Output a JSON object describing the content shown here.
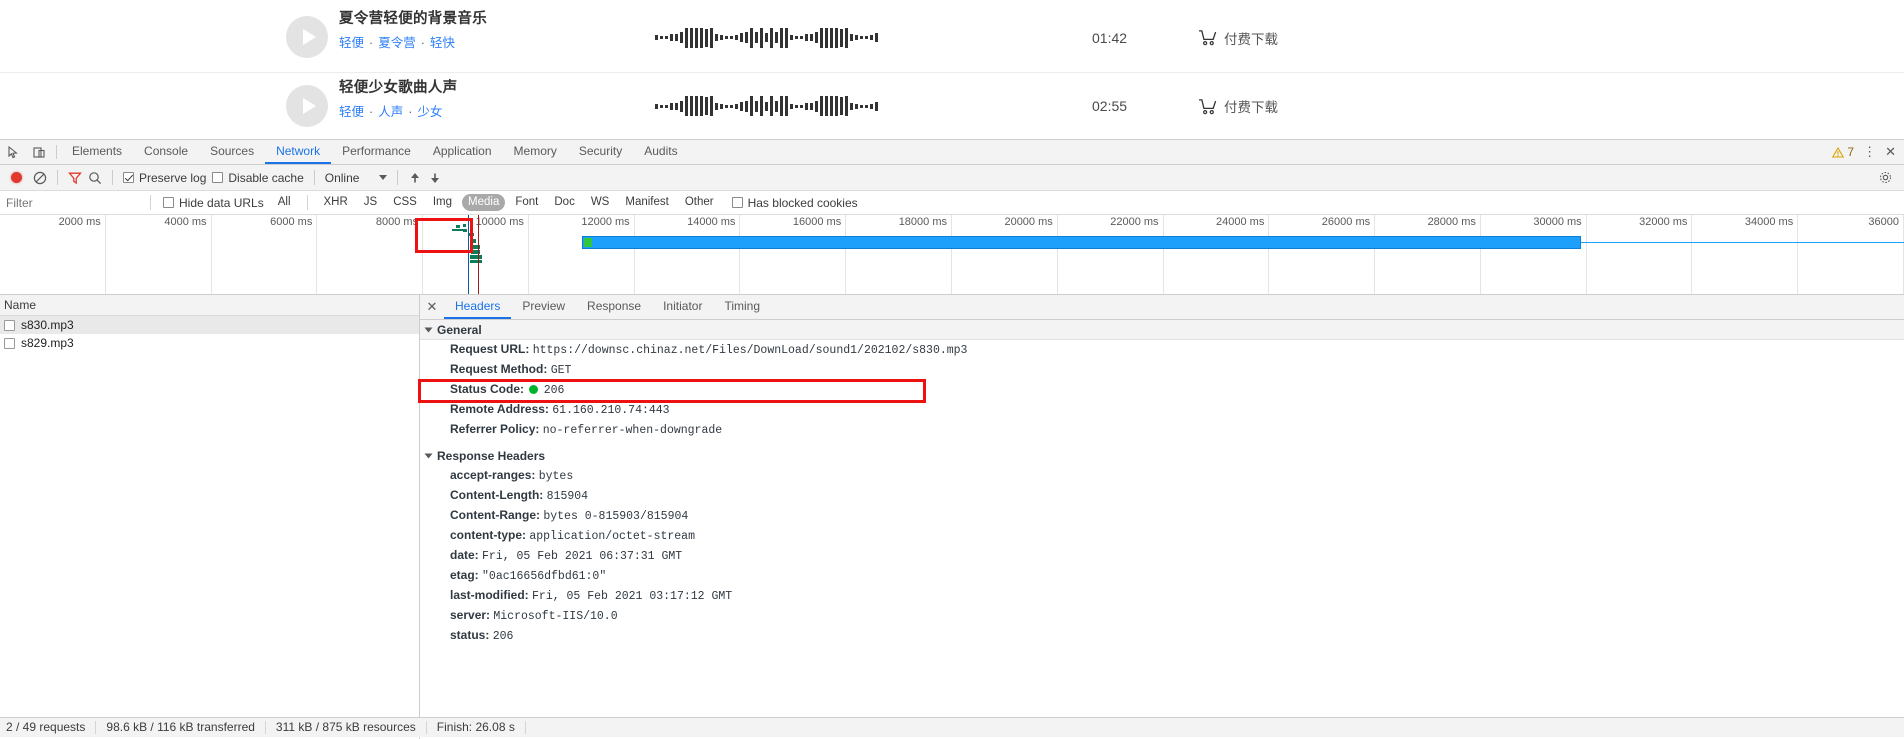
{
  "webpage": {
    "tracks": [
      {
        "title": "夏令营轻便的背景音乐",
        "tags": [
          "轻便",
          "夏令营",
          "轻快"
        ],
        "duration": "01:42",
        "download_label": "付费下载"
      },
      {
        "title": "轻便少女歌曲人声",
        "tags": [
          "轻便",
          "人声",
          "少女"
        ],
        "duration": "02:55",
        "download_label": "付费下载"
      }
    ],
    "waveform_heights": [
      5,
      3,
      3,
      7,
      7,
      11,
      20,
      20,
      20,
      20,
      18,
      20,
      7,
      5,
      3,
      3,
      5,
      9,
      11,
      20,
      11,
      20,
      9,
      20,
      11,
      20,
      20
    ]
  },
  "devtools": {
    "main_tabs": [
      {
        "label": "Elements",
        "active": false
      },
      {
        "label": "Console",
        "active": false
      },
      {
        "label": "Sources",
        "active": false
      },
      {
        "label": "Network",
        "active": true
      },
      {
        "label": "Performance",
        "active": false
      },
      {
        "label": "Application",
        "active": false
      },
      {
        "label": "Memory",
        "active": false
      },
      {
        "label": "Security",
        "active": false
      },
      {
        "label": "Audits",
        "active": false
      }
    ],
    "warning_count": "7",
    "icons": {
      "inspect": "inspect-element-icon",
      "device": "device-toolbar-icon",
      "warning": "warning-triangle-icon",
      "more": "more-vertical-icon",
      "close": "close-icon",
      "settings": "gear-icon"
    },
    "network_toolbar": {
      "record_title": "record-button",
      "clear_title": "clear-button",
      "filter_title": "filter-button",
      "search_title": "search-button",
      "preserve_log_label": "Preserve log",
      "preserve_log_checked": true,
      "disable_cache_label": "Disable cache",
      "disable_cache_checked": false,
      "throttling_value": "Online",
      "import_title": "import-har-button",
      "export_title": "export-har-button"
    },
    "filter_bar": {
      "filter_placeholder": "Filter",
      "hide_data_urls_label": "Hide data URLs",
      "hide_data_urls_checked": false,
      "types": [
        {
          "label": "All",
          "selected": false
        },
        {
          "label": "XHR",
          "selected": false
        },
        {
          "label": "JS",
          "selected": false
        },
        {
          "label": "CSS",
          "selected": false
        },
        {
          "label": "Img",
          "selected": false
        },
        {
          "label": "Media",
          "selected": true
        },
        {
          "label": "Font",
          "selected": false
        },
        {
          "label": "Doc",
          "selected": false
        },
        {
          "label": "WS",
          "selected": false
        },
        {
          "label": "Manifest",
          "selected": false
        },
        {
          "label": "Other",
          "selected": false
        }
      ],
      "blocked_cookies_label": "Has blocked cookies",
      "blocked_cookies_checked": false
    },
    "overview": {
      "ticks": [
        "2000 ms",
        "4000 ms",
        "6000 ms",
        "8000 ms",
        "10000 ms",
        "12000 ms",
        "14000 ms",
        "16000 ms",
        "18000 ms",
        "20000 ms",
        "22000 ms",
        "24000 ms",
        "26000 ms",
        "28000 ms",
        "30000 ms",
        "32000 ms",
        "34000 ms",
        "36000"
      ],
      "bar_start_ms": 11000,
      "bar_end_ms": 29900,
      "max_ms": 36000,
      "bar_color": "#1ca0fb",
      "start_marker_color": "#33c73f",
      "dom_content_loaded_color": "#0b5b9e",
      "load_event_color": "#9a1c1c"
    },
    "requests": {
      "column_name": "Name",
      "rows": [
        {
          "name": "s830.mp3",
          "selected": true
        },
        {
          "name": "s829.mp3",
          "selected": false
        }
      ]
    },
    "details": {
      "tabs": [
        {
          "label": "Headers",
          "active": true
        },
        {
          "label": "Preview",
          "active": false
        },
        {
          "label": "Response",
          "active": false
        },
        {
          "label": "Initiator",
          "active": false
        },
        {
          "label": "Timing",
          "active": false
        }
      ],
      "general_section": "General",
      "general": [
        {
          "key": "Request URL:",
          "value": "https://downsc.chinaz.net/Files/DownLoad/sound1/202102/s830.mp3",
          "highlighted": true
        },
        {
          "key": "Request Method:",
          "value": "GET"
        },
        {
          "key": "Status Code:",
          "value": "206",
          "status_dot": true
        },
        {
          "key": "Remote Address:",
          "value": "61.160.210.74:443"
        },
        {
          "key": "Referrer Policy:",
          "value": "no-referrer-when-downgrade"
        }
      ],
      "response_section": "Response Headers",
      "response_headers": [
        {
          "key": "accept-ranges:",
          "value": "bytes"
        },
        {
          "key": "Content-Length:",
          "value": "815904"
        },
        {
          "key": "Content-Range:",
          "value": "bytes 0-815903/815904"
        },
        {
          "key": "content-type:",
          "value": "application/octet-stream"
        },
        {
          "key": "date:",
          "value": "Fri, 05 Feb 2021 06:37:31 GMT"
        },
        {
          "key": "etag:",
          "value": "\"0ac16656dfbd61:0\""
        },
        {
          "key": "last-modified:",
          "value": "Fri, 05 Feb 2021 03:17:12 GMT"
        },
        {
          "key": "server:",
          "value": "Microsoft-IIS/10.0"
        },
        {
          "key": "status:",
          "value": "206"
        }
      ]
    },
    "status_bar": {
      "requests": "2 / 49 requests",
      "transferred": "98.6 kB / 116 kB transferred",
      "resources": "311 kB / 875 kB resources",
      "finish": "Finish: 26.08 s"
    },
    "annotation_color": "#ee1111"
  }
}
